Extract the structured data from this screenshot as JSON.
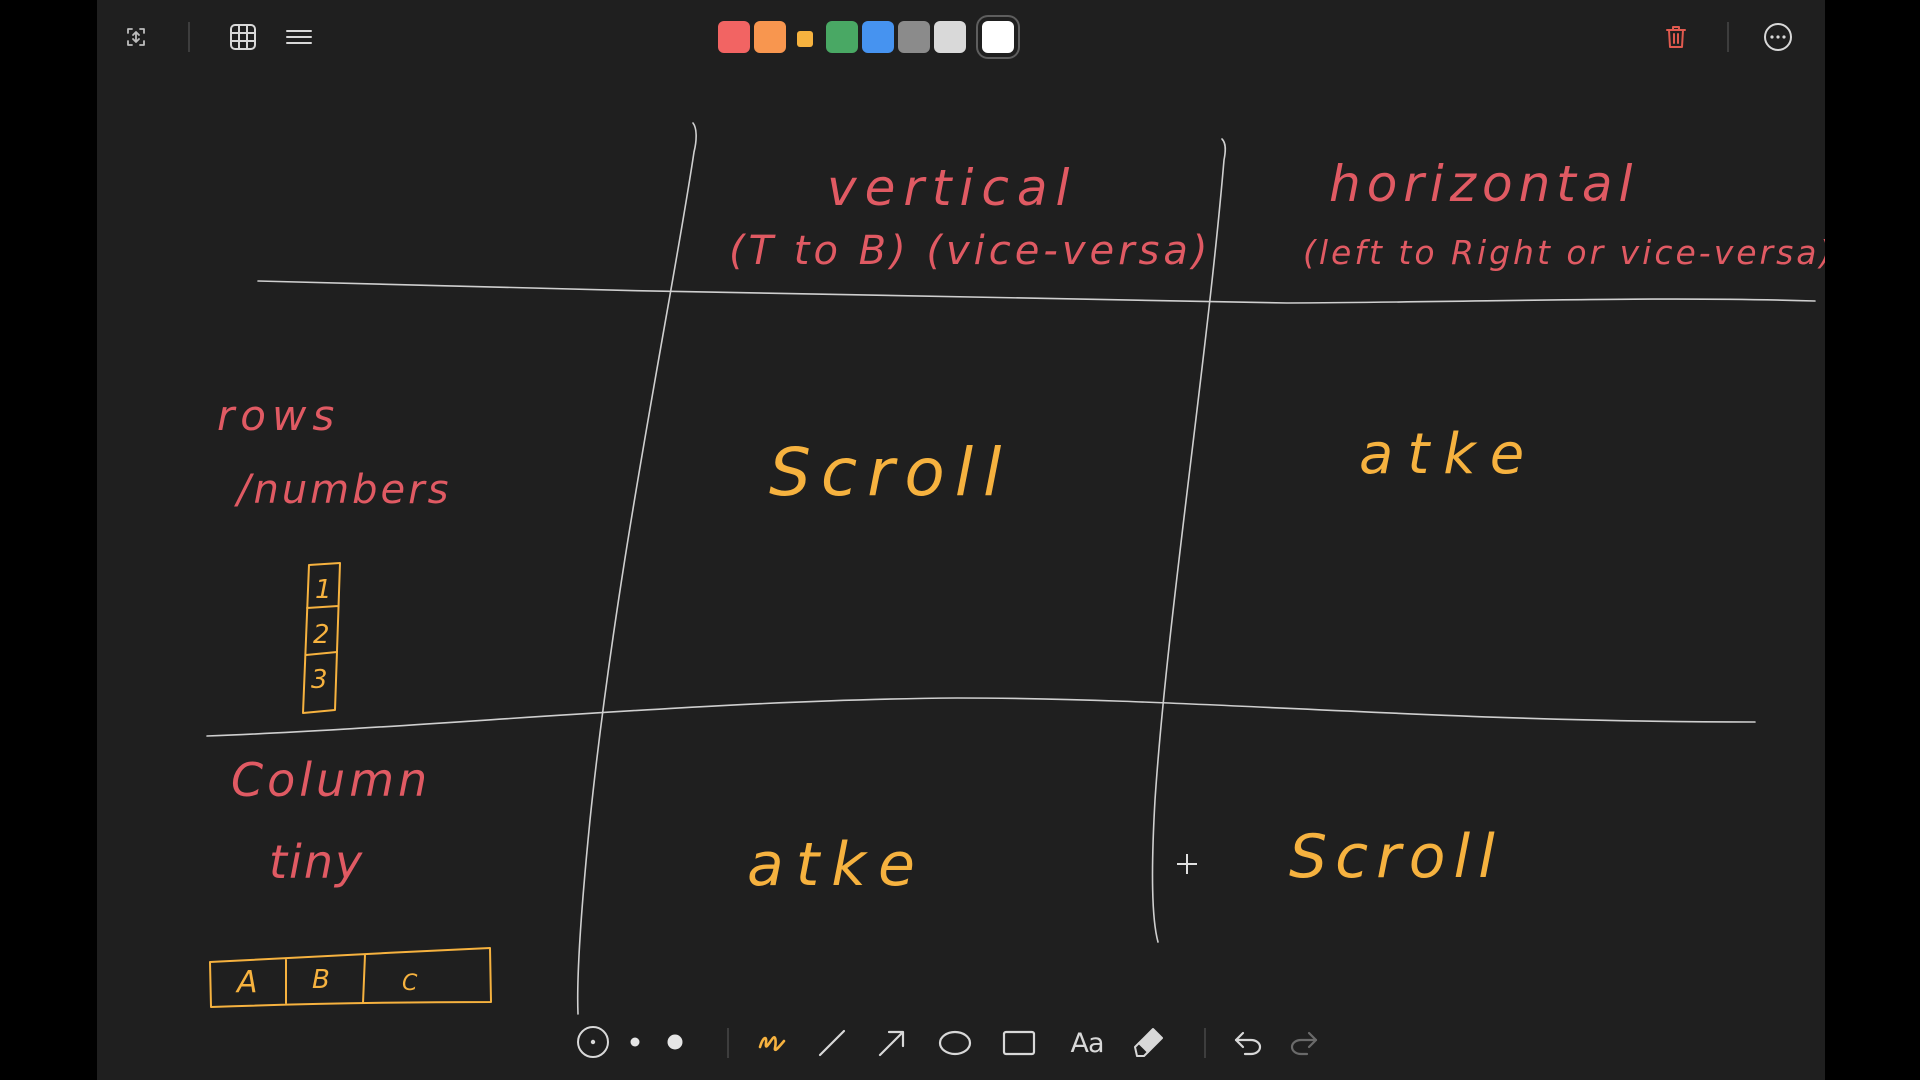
{
  "toolbar_top": {
    "fullscreen_icon": "fullscreen-toggle-icon",
    "grid_icon": "grid-icon",
    "menu_icon": "menu-lines-icon",
    "trash_icon": "trash-icon",
    "more_icon": "more-options-icon",
    "colors": [
      "#f26463",
      "#f8964f",
      "#f6b23f",
      "#49a864",
      "#4693f0",
      "#8b8b8b",
      "#d9d9d9",
      "#ffffff"
    ],
    "selected_color": "#ffffff",
    "trash_color": "#e05a4f"
  },
  "toolbar_bottom": {
    "tools": [
      "laser-pointer-icon",
      "small-dot-icon",
      "large-dot-icon",
      "pen-icon",
      "line-icon",
      "arrow-icon",
      "ellipse-icon",
      "rectangle-icon",
      "text-tool-icon",
      "eraser-icon",
      "undo-icon",
      "redo-icon"
    ],
    "text_tool_label": "Aa",
    "pen_color": "#f6b23f"
  },
  "canvas": {
    "header_vertical": "vertical",
    "header_vertical_sub": "(T to B) (vice-versa)",
    "header_horizontal": "horizontal",
    "header_horizontal_sub": "(left to Right or vice-versa)",
    "row1_label_a": "rows",
    "row1_label_b": "/numbers",
    "row1_cells": [
      "1",
      "2",
      "3"
    ],
    "row2_label_a": "Column",
    "row2_label_b": "tiny",
    "row2_cells": [
      "A",
      "B",
      "C"
    ],
    "cell_r1_vertical": "Scroll",
    "cell_r1_horizontal": "atke",
    "cell_r2_vertical": "atke",
    "cell_r2_horizontal": "Scroll",
    "ink_red": "#e05a63",
    "ink_orange": "#f6b23f",
    "ink_grey": "#cfcfcf"
  }
}
